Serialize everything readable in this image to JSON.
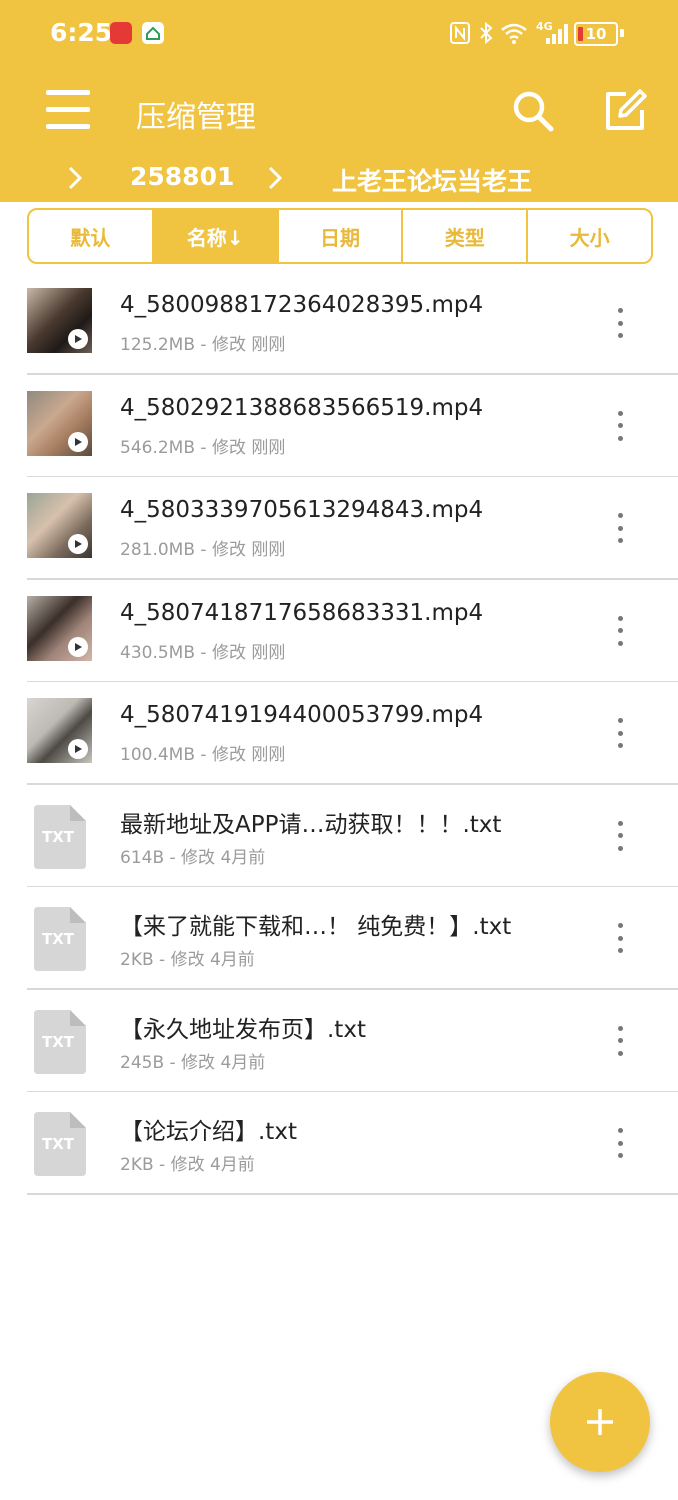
{
  "status_bar": {
    "time": "6:25",
    "network": "4G",
    "battery": "10",
    "icons": [
      "huawei-app-icon",
      "green-app-icon",
      "nfc-icon",
      "bluetooth-icon",
      "wifi-icon",
      "cellular-signal-icon",
      "battery-icon"
    ]
  },
  "toolbar": {
    "title": "压缩管理",
    "icons": [
      "menu-icon",
      "search-icon",
      "edit-icon"
    ]
  },
  "breadcrumb": {
    "items": [
      "258801",
      "上老王论坛当老王"
    ]
  },
  "sort_tabs": [
    {
      "label": "默认",
      "active": false
    },
    {
      "label": "名称↓",
      "active": true
    },
    {
      "label": "日期",
      "active": false
    },
    {
      "label": "类型",
      "active": false
    },
    {
      "label": "大小",
      "active": false
    }
  ],
  "files": [
    {
      "name": "4_5800988172364028395.mp4",
      "meta": "125.2MB - 修改 刚刚",
      "type": "video"
    },
    {
      "name": "4_5802921388683566519.mp4",
      "meta": "546.2MB - 修改 刚刚",
      "type": "video"
    },
    {
      "name": "4_5803339705613294843.mp4",
      "meta": "281.0MB - 修改 刚刚",
      "type": "video"
    },
    {
      "name": "4_5807418717658683331.mp4",
      "meta": "430.5MB - 修改 刚刚",
      "type": "video"
    },
    {
      "name": "4_5807419194400053799.mp4",
      "meta": "100.4MB - 修改 刚刚",
      "type": "video"
    },
    {
      "name": "最新地址及APP请…动获取！！！.txt",
      "meta": "614B - 修改 4月前",
      "type": "txt"
    },
    {
      "name": "【来了就能下载和…！ 纯免费！】.txt",
      "meta": "2KB - 修改 4月前",
      "type": "txt"
    },
    {
      "name": "【永久地址发布页】.txt",
      "meta": "245B - 修改 4月前",
      "type": "txt"
    },
    {
      "name": "【论坛介绍】.txt",
      "meta": "2KB - 修改 4月前",
      "type": "txt"
    }
  ],
  "txt_icon_label": "TXT",
  "fab": {
    "icon": "plus-icon"
  },
  "colors": {
    "accent": "#F0C340",
    "text": "#222222",
    "secondary": "#9b9b9b"
  }
}
